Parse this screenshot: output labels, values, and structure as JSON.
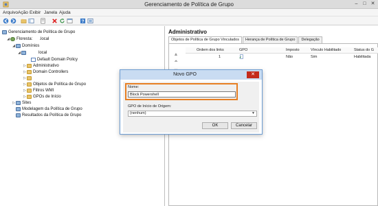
{
  "window": {
    "title": "Gerenciamento de Política de Grupo"
  },
  "menu": {
    "items": [
      "Arquivo",
      "Ação",
      "Exibir",
      "Janela",
      "Ajuda"
    ]
  },
  "toolbar": {
    "icons": [
      "back-arrow-icon",
      "forward-arrow-icon",
      "folder-icon",
      "console-tree-icon",
      "properties-icon",
      "delete-icon",
      "refresh-icon",
      "export-icon",
      "help-icon",
      "view-icon"
    ]
  },
  "tree": {
    "root": "Gerenciamento de Política de Grupo",
    "forest": "Floresta:",
    "forest_suffix": ".local",
    "domains": "Domínios",
    "domain": "local",
    "children": [
      "Default Domain Policy",
      "Administrativo",
      "Domain Controllers",
      "",
      "Objetos de Política de Grupo",
      "Filtros WMI",
      "GPOs de Início"
    ],
    "sites": "Sites",
    "modeling": "Modelagem da Política de Grupo",
    "results": "Resultados da Política de Grupo"
  },
  "right": {
    "title": "Administrativo",
    "tabs": [
      "Objetos de Política de Grupo Vinculados",
      "Herança de Política de Grupo",
      "Delegação"
    ],
    "columns": [
      "Ordem dos links",
      "GPO",
      "Imposto",
      "Vínculo Habilitado",
      "Status do G"
    ],
    "rows": [
      {
        "order": "1",
        "gpo": "",
        "enforced": "Não",
        "enabled": "Sim",
        "status": "Habilitada"
      }
    ]
  },
  "dialog": {
    "title": "Novo GPO",
    "close": "✕",
    "name_label": "Nome:",
    "name_value": "Block Powershell",
    "source_label": "GPO de Início de Origem:",
    "source_value": "(nenhum)",
    "ok": "OK",
    "cancel": "Cancelar"
  },
  "colors": {
    "highlight": "#e67e22",
    "close": "#c42b1c",
    "dialog_title": "#c9dcf2"
  }
}
